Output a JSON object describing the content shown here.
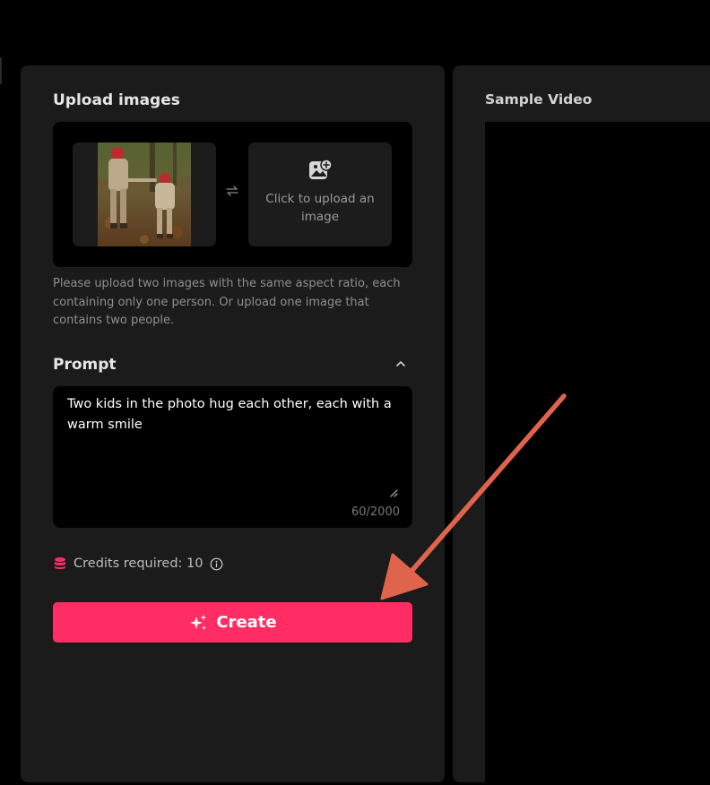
{
  "upload": {
    "title": "Upload images",
    "upload_prompt": "Click to upload an image",
    "hint": "Please upload two images with the same aspect ratio, each containing only one person. Or upload one image that contains two people."
  },
  "prompt": {
    "title": "Prompt",
    "text": "Two kids in the photo hug each other, each with a warm smile",
    "counter": "60/2000"
  },
  "credits": {
    "text": "Credits required: 10"
  },
  "create": {
    "label": "Create"
  },
  "sample": {
    "title": "Sample Video"
  },
  "colors": {
    "accent": "#ff2d63",
    "panel": "#1b1b1c",
    "annotation_arrow": "#e0644c"
  },
  "icons": [
    "swap-icon",
    "image-add-icon",
    "chevron-up-icon",
    "resize-grip-icon",
    "database-icon",
    "info-icon",
    "sparkle-icon"
  ]
}
